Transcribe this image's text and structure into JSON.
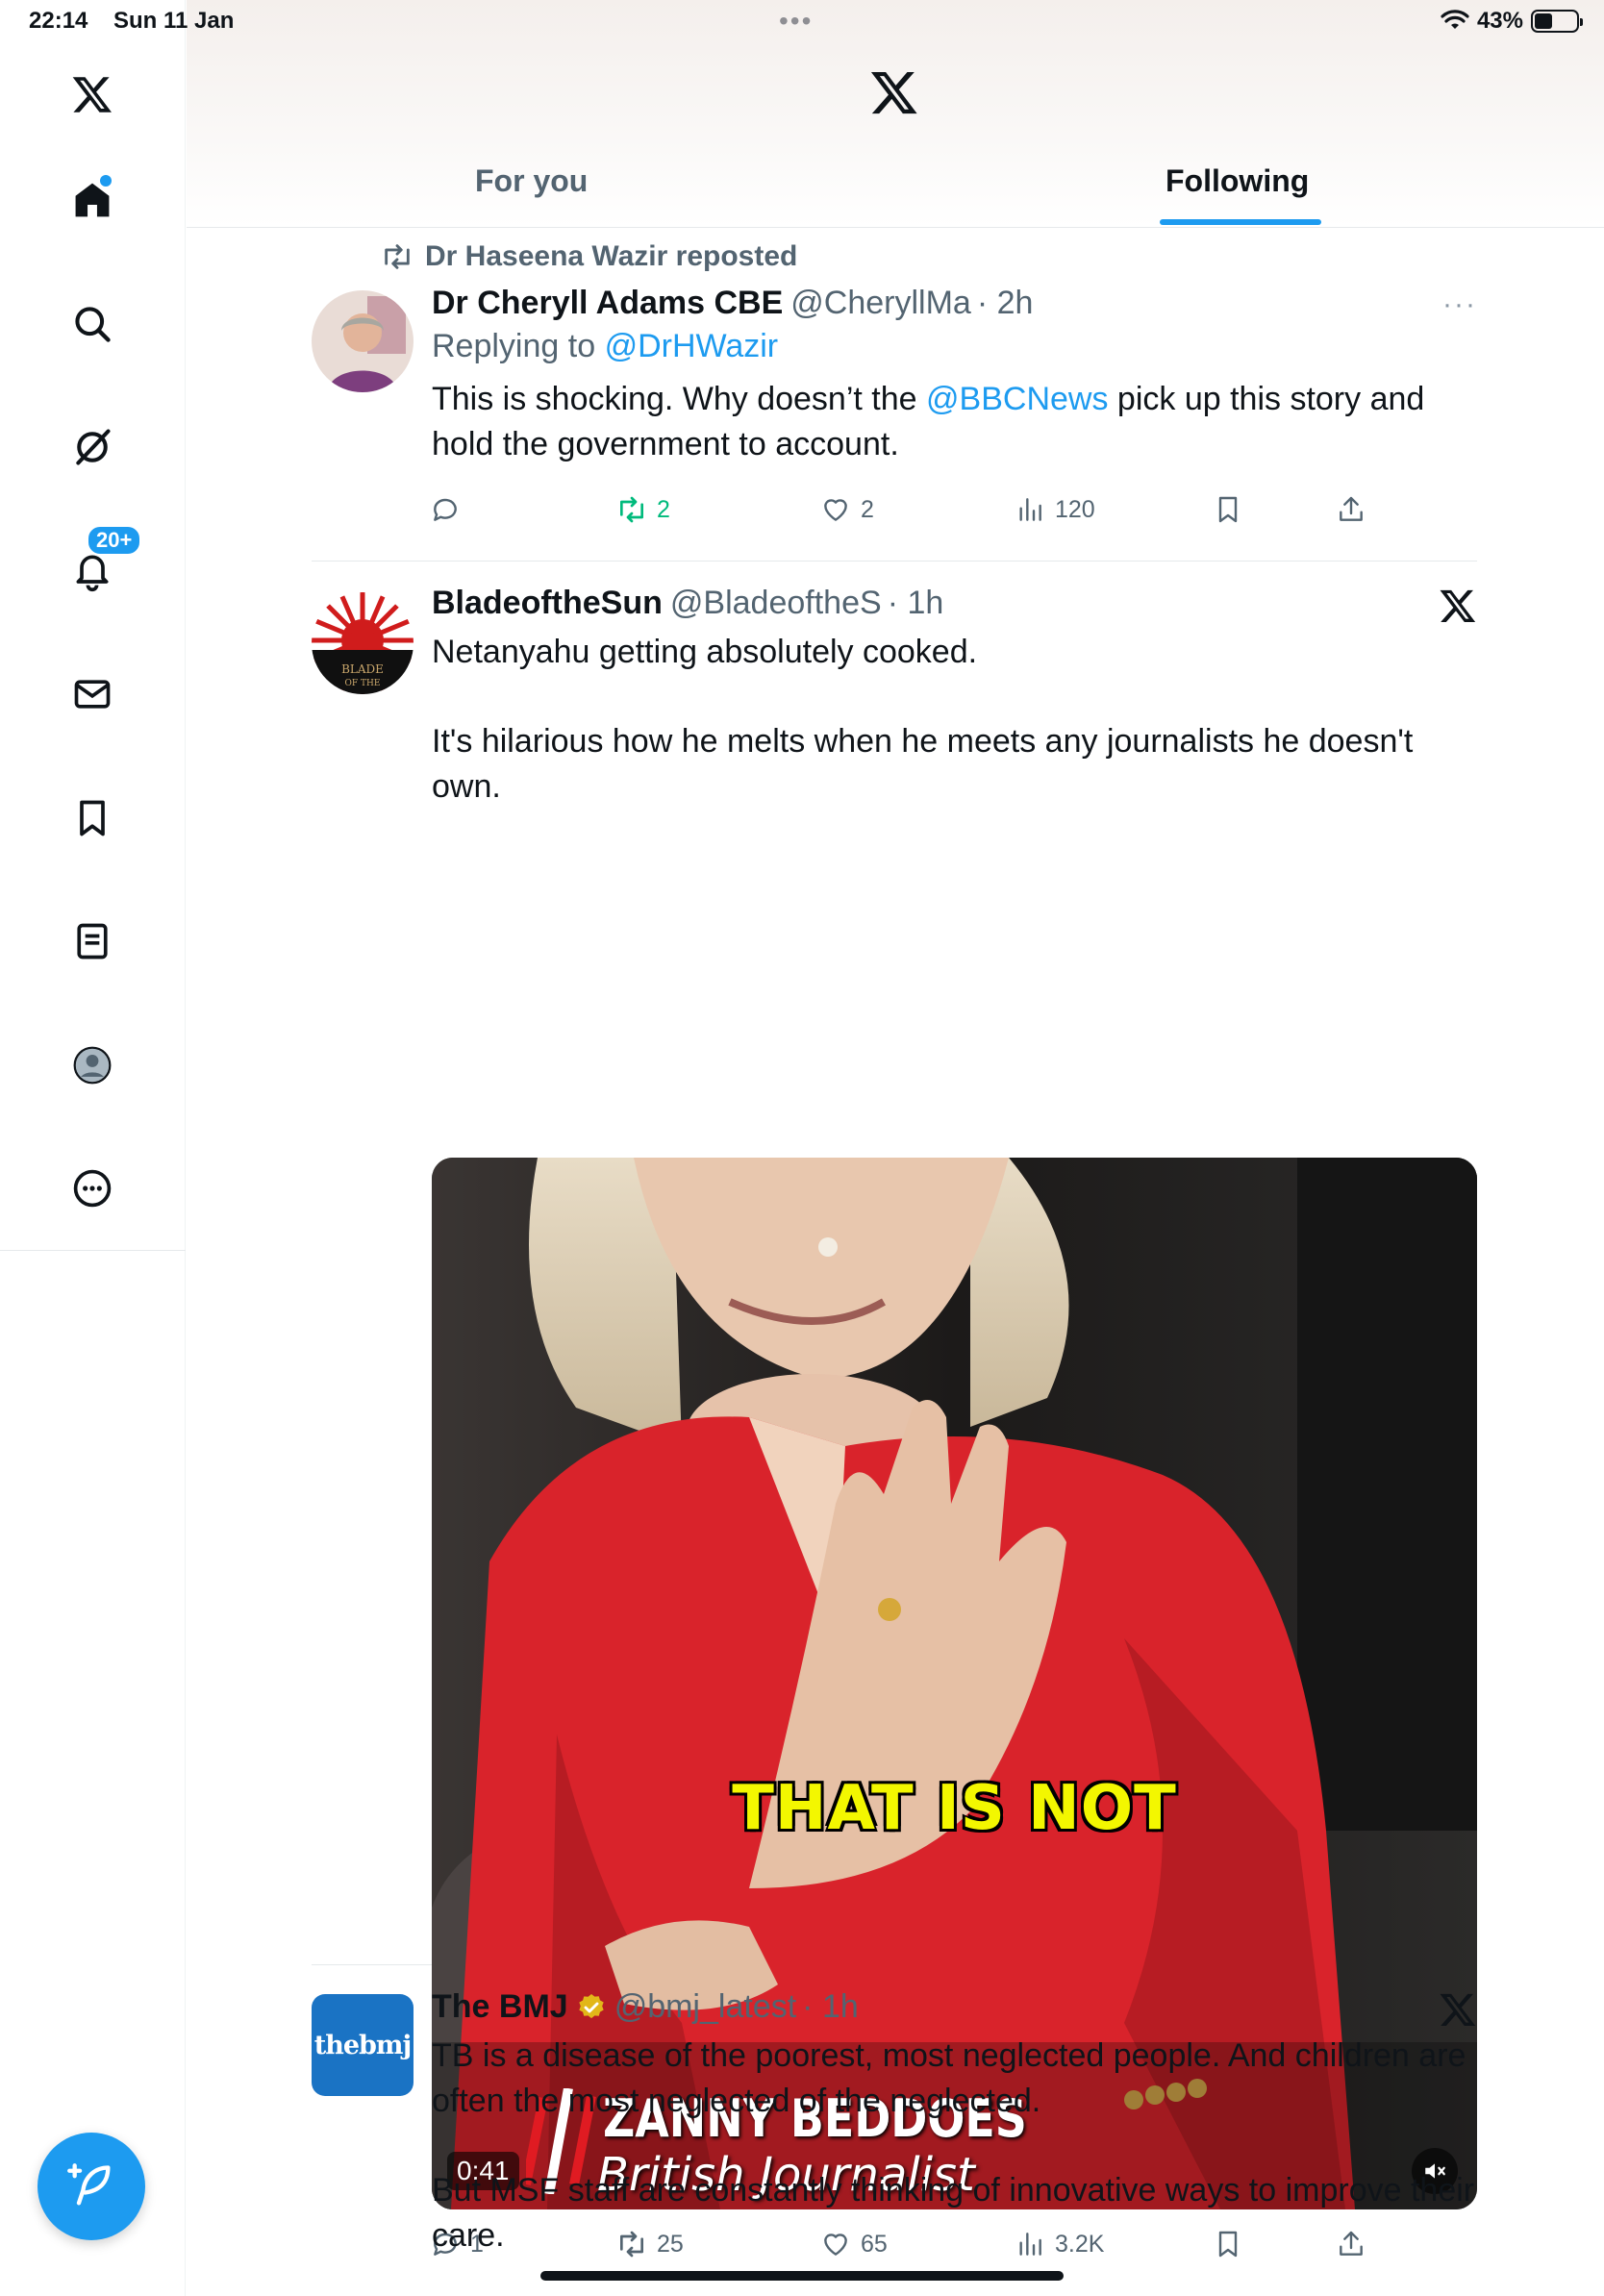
{
  "status_bar": {
    "time": "22:14",
    "date": "Sun 11 Jan",
    "battery": "43%",
    "battery_level": 0.43
  },
  "sidebar": {
    "items": [
      {
        "name": "logo",
        "icon": "x-logo-icon"
      },
      {
        "name": "home",
        "icon": "home-icon",
        "has_dot": true
      },
      {
        "name": "explore",
        "icon": "search-icon"
      },
      {
        "name": "grok",
        "icon": "grok-icon"
      },
      {
        "name": "notifications",
        "icon": "bell-icon",
        "badge": "20+"
      },
      {
        "name": "messages",
        "icon": "mail-icon"
      },
      {
        "name": "bookmarks",
        "icon": "bookmark-icon"
      },
      {
        "name": "lists",
        "icon": "list-icon"
      },
      {
        "name": "profile",
        "icon": "avatar-icon"
      },
      {
        "name": "more",
        "icon": "more-circle-icon"
      }
    ],
    "compose_icon": "compose-feather-icon"
  },
  "header": {
    "tabs": [
      {
        "label": "For you",
        "active": false
      },
      {
        "label": "Following",
        "active": true
      }
    ]
  },
  "tweets": [
    {
      "repost_by": "Dr Haseena Wazir reposted",
      "name": "Dr Cheryll Adams CBE",
      "handle": "@CheryllMa",
      "time": "· 2h",
      "reply_prefix": "Replying to",
      "reply_to": "@DrHWazir",
      "text_a": "This is shocking. Why doesn’t the ",
      "text_link": "@BBCNews",
      "text_b": " pick up this story and hold the government to account.",
      "replies": "",
      "reposts": "2",
      "likes": "2",
      "views": "120"
    },
    {
      "name": "BladeoftheSun",
      "handle": "@BladeoftheS",
      "time": "· 1h",
      "text_1": "Netanyahu getting absolutely cooked.",
      "text_2": "It's hilarious how he melts when he meets any journalists he doesn't own.",
      "video": {
        "caption": "THAT IS NOT",
        "lower_third_name": "ZANNY BEDDOES",
        "lower_third_title": "British Journalist",
        "duration": "0:41"
      },
      "replies": "1",
      "reposts": "25",
      "likes": "65",
      "views": "3.2K"
    },
    {
      "name": "The BMJ",
      "handle": "@bmj_latest",
      "time": "· 1h",
      "avatar_text": "thebmj",
      "text_1": "TB is a disease of the poorest, most neglected people. And children are often the most neglected of the neglected.",
      "text_2": "But MSF staff are constantly thinking of innovative ways to improve their care."
    }
  ],
  "colors": {
    "accent": "#1d9bf0",
    "repost_green": "#00ba7c",
    "secondary_text": "#536471",
    "verified_gold": "#e2b719"
  }
}
